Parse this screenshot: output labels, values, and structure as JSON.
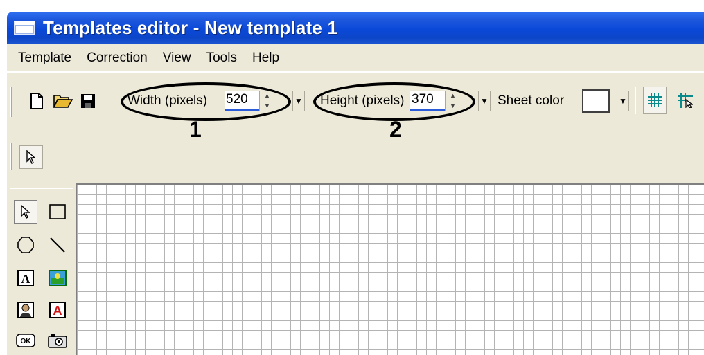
{
  "window": {
    "title": "Templates editor - New template 1"
  },
  "menu": {
    "items": [
      "Template",
      "Correction",
      "View",
      "Tools",
      "Help"
    ]
  },
  "toolbar": {
    "width_label": "Width (pixels)",
    "width_value": "520",
    "height_label": "Height (pixels)",
    "height_value": "370",
    "sheet_color_label": "Sheet color",
    "sheet_color": "#ffffff",
    "icons": [
      "new-file-icon",
      "open-folder-icon",
      "save-icon",
      "grid-icon",
      "snap-to-grid-icon"
    ]
  },
  "callouts": {
    "one": "1",
    "two": "2"
  },
  "palette": {
    "tools": [
      "pointer-tool-icon",
      "rectangle-tool-icon",
      "ellipse-tool-icon",
      "line-tool-icon",
      "text-tool-icon",
      "image-tool-icon",
      "photo-tool-icon",
      "red-text-tool-icon",
      "ok-button-tool-icon",
      "camera-tool-icon"
    ]
  },
  "colors": {
    "titlebar": "#0a48d8",
    "chrome": "#ece9d8",
    "grid_lines": "#b4b4b4",
    "spin_accent": "#2a5bd8"
  }
}
